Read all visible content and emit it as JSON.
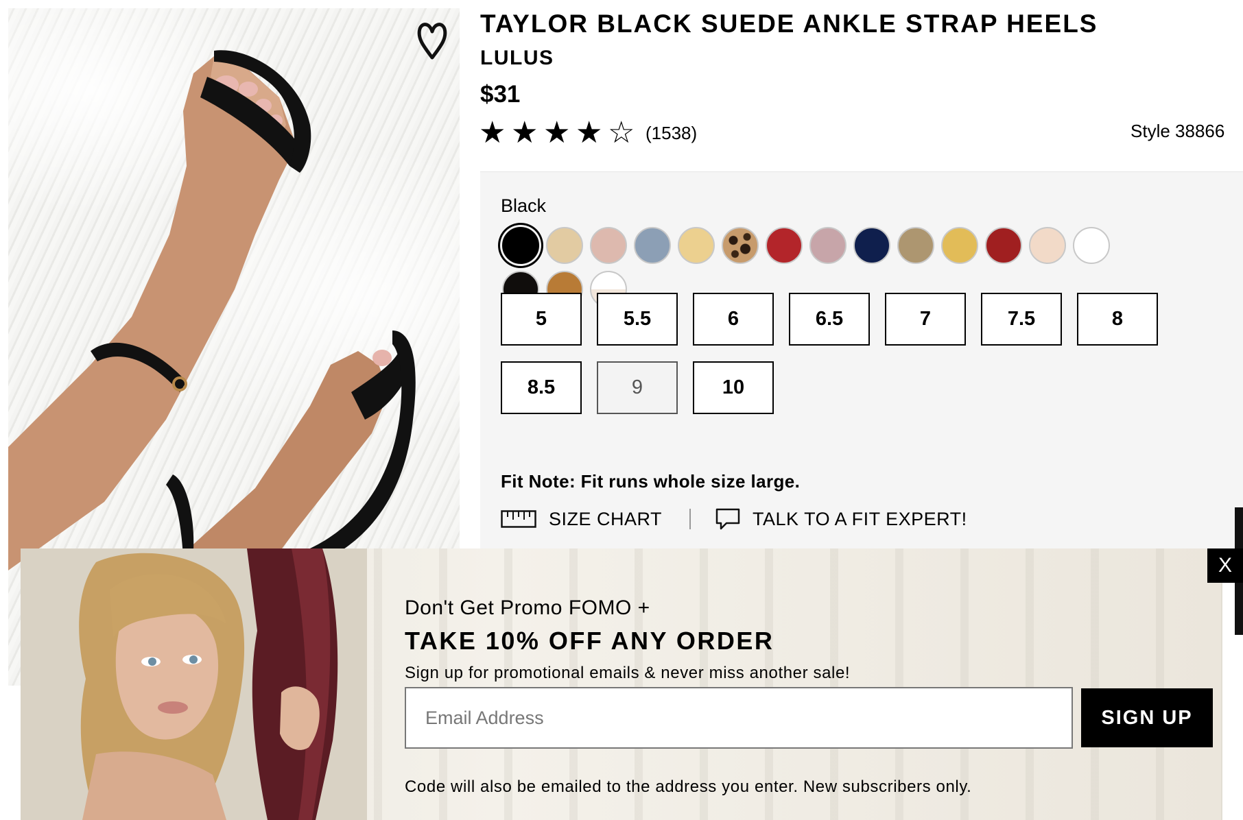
{
  "product": {
    "title": "TAYLOR BLACK SUEDE ANKLE STRAP HEELS",
    "brand": "LULUS",
    "price": "$31",
    "rating": 4,
    "rating_max": 5,
    "review_count": "(1538)",
    "style_number": "Style 38866"
  },
  "colors": {
    "selected_label": "Black",
    "swatches": [
      {
        "name": "black",
        "color": "#000000",
        "selected": true
      },
      {
        "name": "nude-tan",
        "color": "#e2cba2"
      },
      {
        "name": "blush",
        "color": "#ddb9ae"
      },
      {
        "name": "slate-blue",
        "color": "#8c9fb5"
      },
      {
        "name": "light-yellow",
        "color": "#ecd08f"
      },
      {
        "name": "leopard",
        "color": "#b48a5e"
      },
      {
        "name": "red",
        "color": "#b3252a"
      },
      {
        "name": "mauve",
        "color": "#c7a5a9"
      },
      {
        "name": "navy",
        "color": "#0f1f4d"
      },
      {
        "name": "taupe",
        "color": "#ad9670"
      },
      {
        "name": "mustard",
        "color": "#e2bc58"
      },
      {
        "name": "wine-red",
        "color": "#a01f20"
      },
      {
        "name": "light-nude",
        "color": "#f2dac8"
      },
      {
        "name": "white",
        "color": "#ffffff"
      },
      {
        "name": "black-2",
        "color": "#100d0c"
      },
      {
        "name": "cognac",
        "color": "#b87b36"
      },
      {
        "name": "white-nude",
        "color": "#f2e6db"
      }
    ]
  },
  "sizes": [
    {
      "label": "5",
      "available": true
    },
    {
      "label": "5.5",
      "available": true
    },
    {
      "label": "6",
      "available": true
    },
    {
      "label": "6.5",
      "available": true
    },
    {
      "label": "7",
      "available": true
    },
    {
      "label": "7.5",
      "available": true
    },
    {
      "label": "8",
      "available": true
    },
    {
      "label": "8.5",
      "available": true
    },
    {
      "label": "9",
      "available": false
    },
    {
      "label": "10",
      "available": true
    }
  ],
  "fit_note": "Fit Note: Fit runs whole size large.",
  "links": {
    "size_chart": "SIZE CHART",
    "fit_expert": "TALK TO A FIT EXPERT!"
  },
  "promo": {
    "kicker": "Don't Get Promo FOMO +",
    "headline": "TAKE 10% OFF ANY ORDER",
    "subtext": "Sign up for promotional emails & never miss another sale!",
    "email_placeholder": "Email Address",
    "email_value": "",
    "button_label": "SIGN UP",
    "fine_print": "Code will also be emailed to the address you enter. New subscribers only.",
    "close_label": "X"
  },
  "icons": {
    "wishlist": "heart-icon",
    "rating_full": "star-filled-icon",
    "rating_empty": "star-outline-icon",
    "size_chart": "ruler-icon",
    "fit_expert": "chat-bubble-icon",
    "close": "close-icon"
  }
}
